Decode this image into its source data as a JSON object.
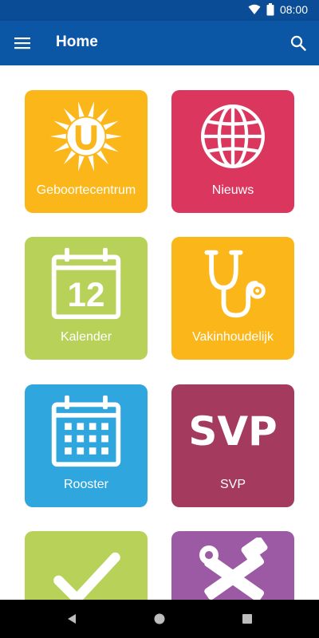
{
  "status_bar": {
    "time": "08:00"
  },
  "app_bar": {
    "title": "Home"
  },
  "tiles": [
    {
      "label": "Geboortecentrum",
      "color": "#fbb61a"
    },
    {
      "label": "Nieuws",
      "color": "#da365e"
    },
    {
      "label": "Kalender",
      "color": "#b7d159"
    },
    {
      "label": "Vakinhoudelijk",
      "color": "#fbb61a"
    },
    {
      "label": "Rooster",
      "color": "#2fa6de"
    },
    {
      "label": "SVP",
      "color": "#a43b5f",
      "icon_text": "SVP"
    },
    {
      "label": "",
      "color": "#b7d159"
    },
    {
      "label": "",
      "color": "#9d5aa4"
    }
  ],
  "calendar_day": "12",
  "colors": {
    "appbar": "#0c56a6",
    "statusbar": "#0a4c95",
    "navbar": "#000000"
  },
  "icons": [
    "sun-logo-icon",
    "globe-icon",
    "calendar-icon",
    "stethoscope-icon",
    "schedule-icon",
    "svp-icon",
    "checkmark-icon",
    "tools-icon"
  ]
}
